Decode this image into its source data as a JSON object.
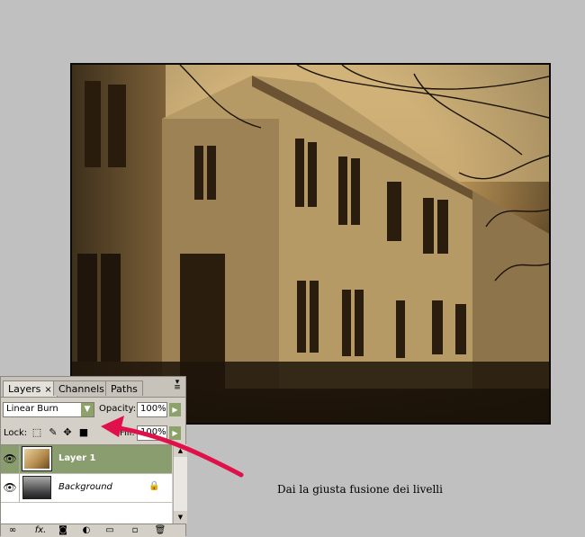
{
  "layers_panel": {
    "tabs": [
      {
        "label": "Layers",
        "close": "×"
      },
      {
        "label": "Channels"
      },
      {
        "label": "Paths"
      }
    ],
    "blend_mode": "Linear Burn",
    "opacity_label": "Opacity:",
    "opacity_value": "100%",
    "lock_label": "Lock:",
    "fill_label": "Fill:",
    "fill_value": "100%",
    "layers": [
      {
        "name": "Layer 1"
      },
      {
        "name": "Background"
      }
    ],
    "fx_label": "fx."
  },
  "caption": "Dai la giusta fusione dei livelli",
  "colors": {
    "selected_layer": "#8a9d6e",
    "arrow": "#e0104a",
    "background": "#c0c0c0"
  }
}
